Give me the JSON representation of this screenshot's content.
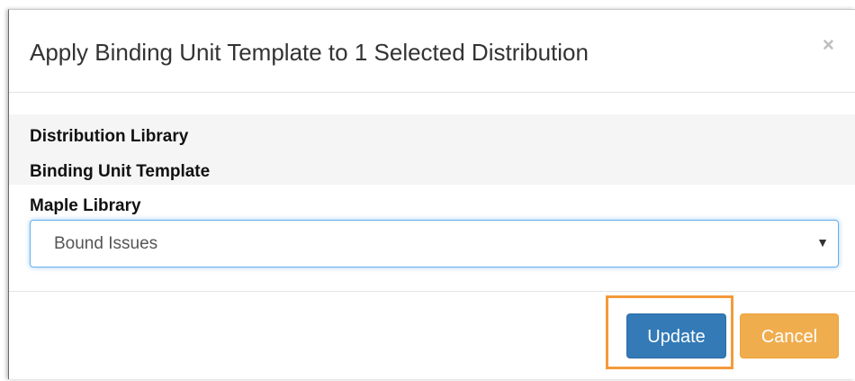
{
  "modal": {
    "title": "Apply Binding Unit Template to 1 Selected Distribution",
    "close_symbol": "×"
  },
  "body": {
    "label_distribution_library": "Distribution Library",
    "label_binding_unit_template": "Binding Unit Template",
    "label_library_value": "Maple Library",
    "template_select": {
      "selected_value": "Bound Issues",
      "arrow_symbol": "▼"
    }
  },
  "footer": {
    "update_label": "Update",
    "cancel_label": "Cancel"
  },
  "colors": {
    "primary": "#337ab7",
    "warning": "#f0ad4e",
    "highlight": "#f39a3c",
    "focus": "#66afe9"
  }
}
